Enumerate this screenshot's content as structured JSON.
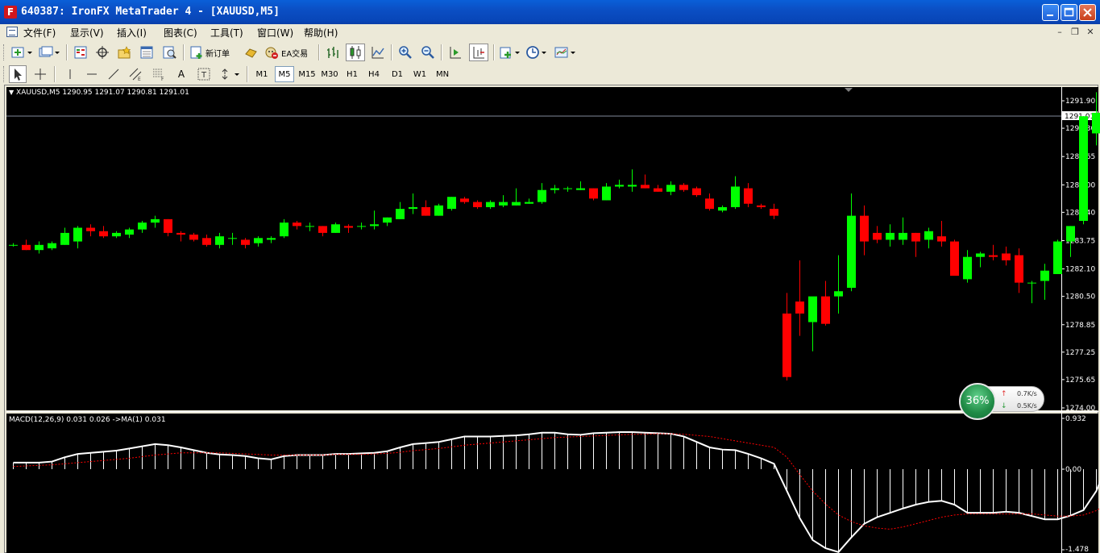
{
  "window": {
    "title": "640387: IronFX MetaTrader 4 - [XAUUSD,M5]",
    "app_icon": "F"
  },
  "menu": {
    "items": [
      "文件(F)",
      "显示(V)",
      "插入(I)",
      "图表(C)",
      "工具(T)",
      "窗口(W)",
      "帮助(H)"
    ]
  },
  "toolbar": {
    "new_order_label": "新订单",
    "ea_trading_label": "EA交易"
  },
  "periods": [
    "M1",
    "M5",
    "M15",
    "M30",
    "H1",
    "H4",
    "D1",
    "W1",
    "MN"
  ],
  "active_period": "M5",
  "drawing_tools": {
    "text_label": "A"
  },
  "search": {
    "value": ""
  },
  "chart": {
    "header": "XAUUSD,M5  1290.95 1291.07 1290.81 1291.01",
    "current_price": "1291.01",
    "macd_header": "MACD(12,26,9) 0.031 0.026  ->MA(1) 0.031",
    "colors": {
      "background": "#000000",
      "bull": "#00ff00",
      "bear": "#ff0000",
      "macd_hist": "#ffffff",
      "signal": "#ff0000"
    }
  },
  "chart_data": {
    "type": "candlestick",
    "symbol": "XAUUSD",
    "timeframe": "M5",
    "price_axis": [
      "1291.90",
      "1290.30",
      "1288.65",
      "1287.00",
      "1285.40",
      "1283.75",
      "1282.10",
      "1280.50",
      "1278.85",
      "1277.25",
      "1275.65",
      "1274.00"
    ],
    "ylim": [
      1274.0,
      1292.7
    ],
    "candles": [
      [
        1283.5,
        1283.6,
        1283.4,
        1283.5
      ],
      [
        1283.5,
        1283.8,
        1283.2,
        1283.2
      ],
      [
        1283.2,
        1283.7,
        1283.0,
        1283.5
      ],
      [
        1283.3,
        1283.7,
        1283.2,
        1283.6
      ],
      [
        1283.5,
        1284.5,
        1283.5,
        1284.2
      ],
      [
        1283.7,
        1284.6,
        1283.3,
        1284.5
      ],
      [
        1284.5,
        1284.7,
        1284.0,
        1284.3
      ],
      [
        1284.3,
        1284.6,
        1283.9,
        1284.0
      ],
      [
        1284.0,
        1284.3,
        1283.9,
        1284.2
      ],
      [
        1284.1,
        1284.5,
        1283.9,
        1284.4
      ],
      [
        1284.4,
        1284.9,
        1284.2,
        1284.8
      ],
      [
        1284.8,
        1285.2,
        1284.5,
        1285.0
      ],
      [
        1285.0,
        1285.0,
        1284.0,
        1284.2
      ],
      [
        1284.2,
        1284.3,
        1283.7,
        1284.1
      ],
      [
        1284.1,
        1284.2,
        1283.7,
        1283.8
      ],
      [
        1283.9,
        1284.1,
        1283.4,
        1283.5
      ],
      [
        1283.5,
        1284.2,
        1283.3,
        1284.0
      ],
      [
        1283.9,
        1284.2,
        1283.5,
        1283.9
      ],
      [
        1283.8,
        1283.9,
        1283.3,
        1283.5
      ],
      [
        1283.6,
        1284.0,
        1283.4,
        1283.9
      ],
      [
        1283.8,
        1284.0,
        1283.6,
        1283.9
      ],
      [
        1284.0,
        1285.0,
        1283.9,
        1284.8
      ],
      [
        1284.8,
        1284.9,
        1284.4,
        1284.6
      ],
      [
        1284.6,
        1284.8,
        1284.3,
        1284.6
      ],
      [
        1284.6,
        1284.6,
        1284.0,
        1284.2
      ],
      [
        1284.2,
        1284.8,
        1284.2,
        1284.7
      ],
      [
        1284.6,
        1284.7,
        1284.2,
        1284.5
      ],
      [
        1284.6,
        1284.8,
        1284.4,
        1284.6
      ],
      [
        1284.6,
        1285.5,
        1284.4,
        1284.7
      ],
      [
        1284.8,
        1285.1,
        1284.6,
        1285.1
      ],
      [
        1285.0,
        1286.0,
        1285.0,
        1285.6
      ],
      [
        1285.6,
        1286.5,
        1285.3,
        1285.7
      ],
      [
        1285.7,
        1286.1,
        1285.2,
        1285.2
      ],
      [
        1285.2,
        1285.9,
        1285.2,
        1285.8
      ],
      [
        1285.6,
        1286.3,
        1285.5,
        1286.3
      ],
      [
        1286.2,
        1286.3,
        1285.9,
        1286.0
      ],
      [
        1286.0,
        1286.1,
        1285.6,
        1285.7
      ],
      [
        1285.7,
        1286.1,
        1285.6,
        1286.0
      ],
      [
        1285.8,
        1286.4,
        1285.7,
        1286.0
      ],
      [
        1285.8,
        1286.8,
        1285.8,
        1286.0
      ],
      [
        1285.9,
        1286.2,
        1285.9,
        1286.0
      ],
      [
        1286.0,
        1287.1,
        1285.9,
        1286.7
      ],
      [
        1286.7,
        1287.0,
        1286.5,
        1286.8
      ],
      [
        1286.8,
        1286.9,
        1286.6,
        1286.8
      ],
      [
        1286.7,
        1287.2,
        1286.7,
        1286.8
      ],
      [
        1286.8,
        1286.8,
        1286.1,
        1286.2
      ],
      [
        1286.1,
        1287.1,
        1286.1,
        1286.9
      ],
      [
        1286.9,
        1287.3,
        1286.8,
        1287.0
      ],
      [
        1286.9,
        1287.9,
        1286.6,
        1287.0
      ],
      [
        1287.0,
        1287.6,
        1286.8,
        1286.8
      ],
      [
        1286.8,
        1287.0,
        1286.6,
        1286.6
      ],
      [
        1286.6,
        1287.2,
        1286.4,
        1287.0
      ],
      [
        1287.0,
        1287.1,
        1286.6,
        1286.7
      ],
      [
        1286.8,
        1286.9,
        1286.3,
        1286.4
      ],
      [
        1286.2,
        1286.5,
        1285.5,
        1285.6
      ],
      [
        1285.5,
        1285.8,
        1285.4,
        1285.7
      ],
      [
        1285.7,
        1287.5,
        1285.6,
        1286.9
      ],
      [
        1286.8,
        1287.1,
        1285.7,
        1285.9
      ],
      [
        1285.8,
        1285.9,
        1285.6,
        1285.7
      ],
      [
        1285.6,
        1285.9,
        1285.0,
        1285.2
      ],
      [
        1279.5,
        1280.7,
        1275.6,
        1275.8
      ],
      [
        1280.2,
        1282.6,
        1278.2,
        1279.5
      ],
      [
        1279.0,
        1280.3,
        1277.3,
        1280.5
      ],
      [
        1280.5,
        1281.4,
        1278.8,
        1278.9
      ],
      [
        1280.5,
        1282.9,
        1279.5,
        1280.8
      ],
      [
        1281.0,
        1286.5,
        1280.8,
        1285.2
      ],
      [
        1285.2,
        1285.8,
        1282.9,
        1283.7
      ],
      [
        1284.2,
        1284.6,
        1283.6,
        1283.8
      ],
      [
        1283.8,
        1284.7,
        1283.4,
        1284.2
      ],
      [
        1283.8,
        1285.1,
        1283.5,
        1284.2
      ],
      [
        1284.2,
        1284.2,
        1282.8,
        1283.7
      ],
      [
        1283.8,
        1284.5,
        1283.3,
        1284.3
      ],
      [
        1284.0,
        1284.9,
        1283.4,
        1283.7
      ],
      [
        1283.7,
        1283.8,
        1281.8,
        1281.7
      ],
      [
        1281.5,
        1283.2,
        1281.3,
        1282.8
      ],
      [
        1282.8,
        1283.1,
        1282.2,
        1283.0
      ],
      [
        1282.9,
        1283.5,
        1282.6,
        1282.8
      ],
      [
        1283.0,
        1283.4,
        1282.3,
        1282.6
      ],
      [
        1282.9,
        1283.3,
        1280.7,
        1281.3
      ],
      [
        1281.3,
        1281.4,
        1280.1,
        1281.3
      ],
      [
        1281.4,
        1282.4,
        1280.3,
        1282.0
      ],
      [
        1281.8,
        1283.8,
        1281.8,
        1283.7
      ],
      [
        1283.7,
        1284.6,
        1282.8,
        1284.6
      ],
      [
        1284.9,
        1291.0,
        1284.7,
        1291.0
      ],
      [
        1290.0,
        1292.4,
        1289.3,
        1291.2
      ],
      [
        1291.3,
        1293.0,
        1291.1,
        1293.0
      ]
    ],
    "macd": {
      "axis_labels": [
        "0.932",
        "0.00",
        "-1.478"
      ],
      "ylim": [
        -1.478,
        0.932
      ],
      "main": [
        0.12,
        0.12,
        0.12,
        0.14,
        0.22,
        0.28,
        0.3,
        0.32,
        0.34,
        0.38,
        0.42,
        0.46,
        0.44,
        0.4,
        0.35,
        0.3,
        0.27,
        0.26,
        0.24,
        0.2,
        0.18,
        0.24,
        0.26,
        0.26,
        0.26,
        0.28,
        0.28,
        0.29,
        0.3,
        0.33,
        0.4,
        0.46,
        0.48,
        0.5,
        0.55,
        0.6,
        0.6,
        0.6,
        0.61,
        0.62,
        0.64,
        0.67,
        0.67,
        0.64,
        0.63,
        0.66,
        0.67,
        0.68,
        0.68,
        0.67,
        0.66,
        0.65,
        0.6,
        0.5,
        0.4,
        0.36,
        0.35,
        0.28,
        0.2,
        0.1,
        -0.4,
        -0.9,
        -1.3,
        -1.45,
        -1.52,
        -1.25,
        -1.0,
        -0.88,
        -0.8,
        -0.72,
        -0.65,
        -0.6,
        -0.58,
        -0.65,
        -0.8,
        -0.8,
        -0.8,
        -0.78,
        -0.8,
        -0.86,
        -0.92,
        -0.92,
        -0.85,
        -0.75,
        -0.4,
        0.2,
        0.95
      ],
      "signal": [
        0.05,
        0.06,
        0.07,
        0.08,
        0.1,
        0.12,
        0.14,
        0.16,
        0.18,
        0.2,
        0.23,
        0.26,
        0.28,
        0.3,
        0.3,
        0.3,
        0.3,
        0.29,
        0.28,
        0.27,
        0.26,
        0.26,
        0.26,
        0.26,
        0.26,
        0.27,
        0.27,
        0.27,
        0.28,
        0.29,
        0.31,
        0.34,
        0.36,
        0.38,
        0.41,
        0.44,
        0.46,
        0.48,
        0.5,
        0.52,
        0.54,
        0.56,
        0.58,
        0.59,
        0.6,
        0.61,
        0.62,
        0.63,
        0.64,
        0.64,
        0.65,
        0.65,
        0.64,
        0.62,
        0.6,
        0.56,
        0.52,
        0.48,
        0.44,
        0.4,
        0.22,
        -0.1,
        -0.4,
        -0.64,
        -0.84,
        -0.96,
        -1.04,
        -1.08,
        -1.1,
        -1.06,
        -1.0,
        -0.94,
        -0.88,
        -0.84,
        -0.82,
        -0.82,
        -0.82,
        -0.82,
        -0.82,
        -0.82,
        -0.84,
        -0.86,
        -0.86,
        -0.84,
        -0.76,
        -0.6,
        -0.3
      ]
    }
  }
}
